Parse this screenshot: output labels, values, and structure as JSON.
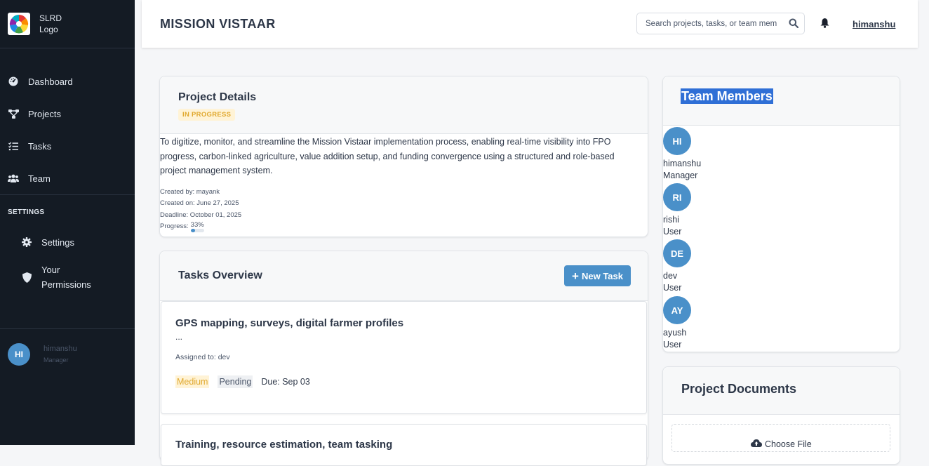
{
  "sidebar": {
    "logo_text": [
      "SLRD",
      "Logo"
    ],
    "nav": [
      {
        "label": "Dashboard",
        "icon": "dashboard-icon"
      },
      {
        "label": "Projects",
        "icon": "projects-icon"
      },
      {
        "label": "Tasks",
        "icon": "tasks-icon"
      },
      {
        "label": "Team",
        "icon": "team-icon"
      }
    ],
    "settings_heading": "SETTINGS",
    "settings_items": [
      {
        "label": "Settings",
        "icon": "gear-icon"
      },
      {
        "label_line1": "Your",
        "label_line2": "Permissions",
        "icon": "shield-icon"
      }
    ],
    "user": {
      "initials": "HI",
      "name": "himanshu",
      "role": "Manager"
    }
  },
  "header": {
    "title": "MISSION VISTAAR",
    "search_placeholder": "Search projects, tasks, or team members",
    "user": "himanshu"
  },
  "project": {
    "heading": "Project Details",
    "status": "IN PROGRESS",
    "description": "To digitize, monitor, and streamline the Mission Vistaar implementation process, enabling real-time visibility into FPO progress, carbon-linked agriculture, value addition setup, and funding convergence using a structured and role-based project management system.",
    "created_by": "Created by: mayank",
    "created_on": "Created on: June 27, 2025",
    "deadline": "Deadline: October 01, 2025",
    "progress_label": "Progress:",
    "progress_text": "33%",
    "progress_value": 0.33
  },
  "tasks": {
    "heading": "Tasks Overview",
    "new_task_label": "New Task",
    "items": [
      {
        "title": "GPS mapping, surveys, digital farmer profiles",
        "excerpt": "...",
        "assigned": "Assigned to: dev",
        "priority": "Medium",
        "status": "Pending",
        "due": "Due: Sep 03"
      },
      {
        "title": "Training, resource estimation, team tasking"
      }
    ]
  },
  "team": {
    "heading": "Team Members",
    "members": [
      {
        "initials": "HI",
        "name": "himanshu",
        "role": "Manager"
      },
      {
        "initials": "RI",
        "name": "rishi",
        "role": "User"
      },
      {
        "initials": "DE",
        "name": "dev",
        "role": "User"
      },
      {
        "initials": "AY",
        "name": "ayush",
        "role": "User"
      }
    ]
  },
  "documents": {
    "heading": "Project Documents",
    "choose_label": "Choose File"
  },
  "colors": {
    "sidebar_bg": "#141b24",
    "accent": "#4a90c9",
    "warning": "#e0a82e",
    "selection": "#2f6fd6"
  }
}
